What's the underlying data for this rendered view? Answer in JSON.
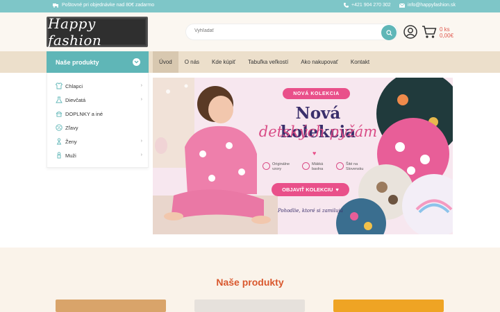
{
  "topbar": {
    "shipping": "Poštovné pri objednávke nad 80€ zadarmo",
    "phone": "+421 904 270 302",
    "email": "info@happyfashion.sk"
  },
  "header": {
    "logo_text": "Happy fashion",
    "search_placeholder": "Vyhľadať",
    "cart_count": "0 ks",
    "cart_total": "0,00€"
  },
  "nav": {
    "category_label": "Naše produkty",
    "links": [
      "Úvod",
      "O nás",
      "Kde kúpiť",
      "Tabuľka veľkostí",
      "Ako nakupovať",
      "Kontakt"
    ]
  },
  "sidebar": {
    "items": [
      {
        "label": "Chlapci",
        "icon": "boy-shirt-icon",
        "has_sub": true
      },
      {
        "label": "Dievčatá",
        "icon": "girl-dress-icon",
        "has_sub": true
      },
      {
        "label": "DOPLNKY a iné",
        "icon": "accessories-icon",
        "has_sub": false
      },
      {
        "label": "Zľavy",
        "icon": "discount-icon",
        "has_sub": false
      },
      {
        "label": "Ženy",
        "icon": "woman-icon",
        "has_sub": true
      },
      {
        "label": "Muži",
        "icon": "man-icon",
        "has_sub": true
      }
    ]
  },
  "banner": {
    "badge": "NOVÁ KOLEKCIA",
    "title_line1": "Nová kolekcia",
    "title_line2": "detských pyžám",
    "features": [
      {
        "line1": "Originálne",
        "line2": "vzory"
      },
      {
        "line1": "Mäkká",
        "line2": "bavlna"
      },
      {
        "line1": "Šité na",
        "line2": "Slovensku"
      }
    ],
    "cta": "OBJAVIŤ KOLEKCIU",
    "tagline": "Pohodlie, ktoré si zamilujú"
  },
  "products": {
    "title": "Naše produkty"
  },
  "colors": {
    "teal": "#5fb6b7",
    "topbar": "#7ec6c8",
    "nav_bg": "#ecdfcb",
    "accent_pink": "#e9508a",
    "accent_orange": "#d9582e",
    "cart_red": "#e0594f"
  }
}
